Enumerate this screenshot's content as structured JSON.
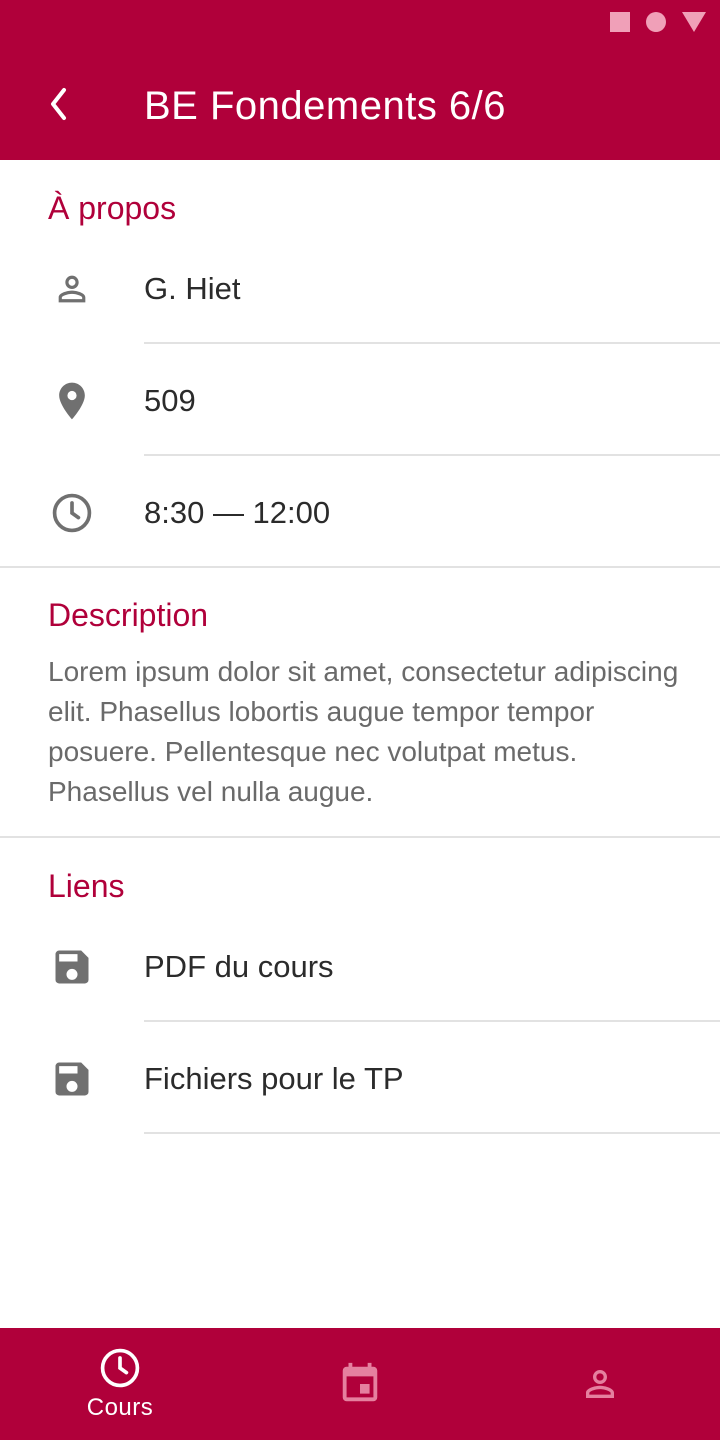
{
  "app_bar": {
    "title": "BE Fondements 6/6"
  },
  "about": {
    "title": "À propos",
    "teacher": "G. Hiet",
    "room": "509",
    "time": "8:30 — 12:00"
  },
  "description": {
    "title": "Description",
    "text": "Lorem ipsum dolor sit amet, consectetur adipiscing elit. Phasellus lobortis augue tempor tempor posuere. Pellentesque nec volutpat metus. Phasellus vel nulla augue."
  },
  "links": {
    "title": "Liens",
    "items": [
      {
        "label": "PDF du cours",
        "icon": "save-icon"
      },
      {
        "label": "Fichiers pour le TP",
        "icon": "save-icon"
      }
    ]
  },
  "bottom_nav": {
    "items": [
      {
        "label": "Cours",
        "icon": "clock-icon",
        "active": true
      },
      {
        "label": "",
        "icon": "calendar-icon",
        "active": false
      },
      {
        "label": "",
        "icon": "person-icon",
        "active": false
      }
    ]
  },
  "colors": {
    "primary": "#b0003a",
    "icon_gray": "#707070",
    "text_dark": "#2b2b2b",
    "text_muted": "#6a6a6a"
  }
}
